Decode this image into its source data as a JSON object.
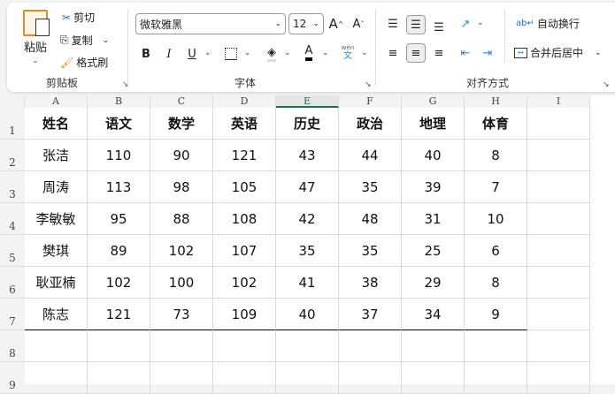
{
  "ribbon": {
    "clipboard": {
      "paste": "粘贴",
      "cut": "剪切",
      "copy": "复制",
      "format_painter": "格式刷",
      "label": "剪贴板"
    },
    "font": {
      "name": "微软雅黑",
      "size": "12",
      "label": "字体",
      "bold": "B",
      "italic": "I",
      "underline": "U",
      "grow": "A",
      "shrink": "A",
      "phonetic_top": "wén",
      "phonetic_bottom": "文",
      "font_color_letter": "A"
    },
    "alignment": {
      "wrap": "自动换行",
      "merge": "合并后居中",
      "label": "对齐方式"
    }
  },
  "sheet": {
    "columns": [
      "A",
      "B",
      "C",
      "D",
      "E",
      "F",
      "G",
      "H",
      "I"
    ],
    "selected_column": "E",
    "rows": [
      "1",
      "2",
      "3",
      "4",
      "5",
      "6",
      "7",
      "8",
      "9"
    ],
    "header": [
      "姓名",
      "语文",
      "数学",
      "英语",
      "历史",
      "政治",
      "地理",
      "体育"
    ],
    "data": [
      [
        "张洁",
        "110",
        "90",
        "121",
        "43",
        "44",
        "40",
        "8"
      ],
      [
        "周涛",
        "113",
        "98",
        "105",
        "47",
        "35",
        "39",
        "7"
      ],
      [
        "李敏敏",
        "95",
        "88",
        "108",
        "42",
        "48",
        "31",
        "10"
      ],
      [
        "樊琪",
        "89",
        "102",
        "107",
        "35",
        "35",
        "25",
        "6"
      ],
      [
        "耿亚楠",
        "102",
        "100",
        "102",
        "41",
        "38",
        "29",
        "8"
      ],
      [
        "陈志",
        "121",
        "73",
        "109",
        "40",
        "37",
        "34",
        "9"
      ]
    ]
  }
}
